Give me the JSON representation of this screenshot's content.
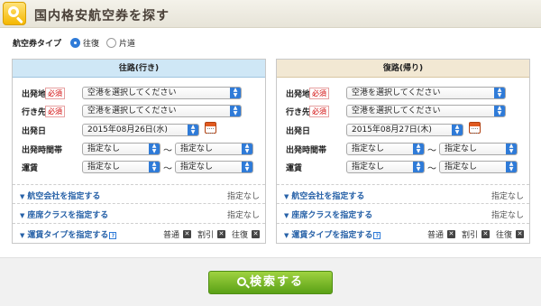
{
  "header": {
    "title": "国内格安航空券を探す"
  },
  "ticket_type": {
    "label": "航空券タイプ",
    "options": [
      "往復",
      "片道"
    ],
    "selected": "往復"
  },
  "outbound": {
    "title": "往路(行き)",
    "from_label": "出発地",
    "to_label": "行き先",
    "required": "必須",
    "from_value": "空港を選択してください",
    "to_value": "空港を選択してください",
    "date_label": "出発日",
    "date_value": "2015年08月26日(水)",
    "time_label": "出発時間帯",
    "time_from": "指定なし",
    "time_to": "指定なし",
    "fare_label": "運賃",
    "fare_from": "指定なし",
    "fare_to": "指定なし"
  },
  "return": {
    "title": "復路(帰り)",
    "from_label": "出発地",
    "to_label": "行き先",
    "required": "必須",
    "from_value": "空港を選択してください",
    "to_value": "空港を選択してください",
    "date_label": "出発日",
    "date_value": "2015年08月27日(木)",
    "time_label": "出発時間帯",
    "time_from": "指定なし",
    "time_to": "指定なし",
    "fare_label": "運賃",
    "fare_from": "指定なし",
    "fare_to": "指定なし"
  },
  "options": {
    "airline": "航空会社を指定する",
    "seat": "座席クラスを指定する",
    "fare_type": "運賃タイプを指定する",
    "none": "指定なし",
    "fare_kinds": [
      "普通",
      "割引",
      "往復"
    ],
    "tilde": "〜"
  },
  "search_button": "検索する"
}
